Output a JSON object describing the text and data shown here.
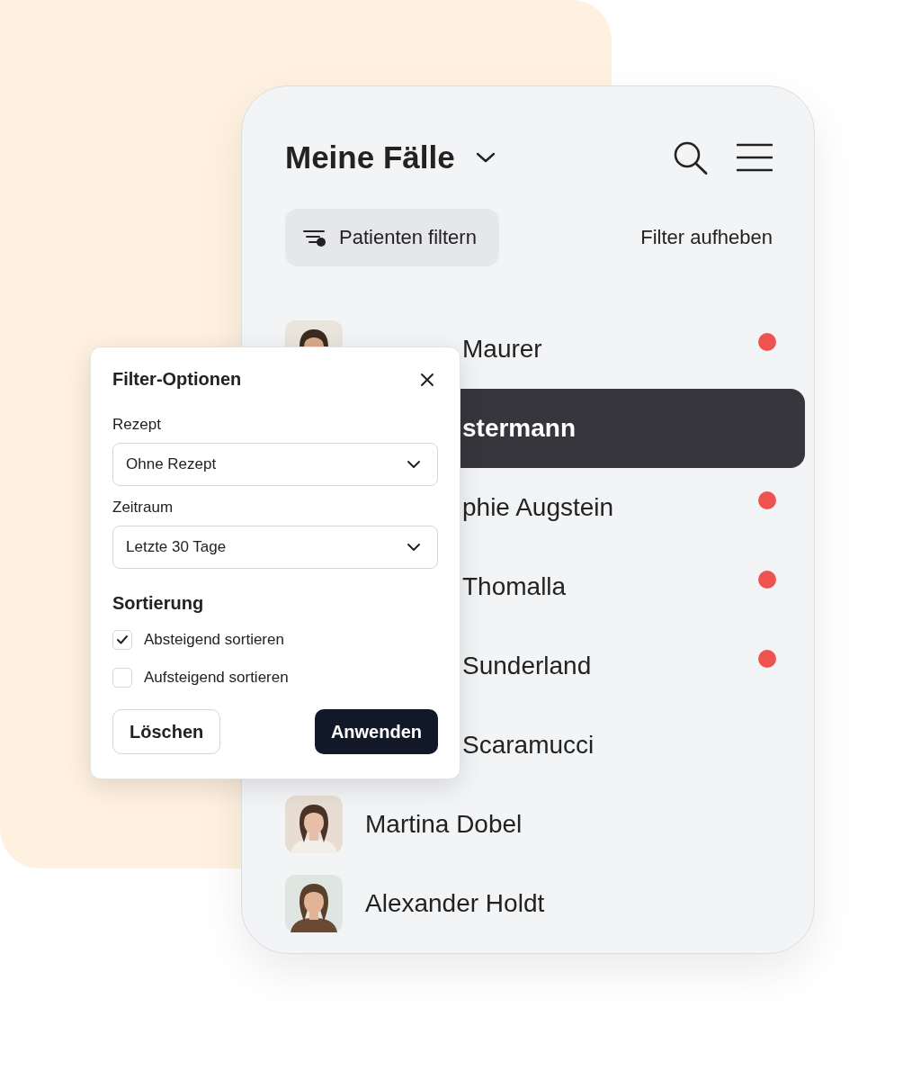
{
  "header": {
    "title": "Meine Fälle"
  },
  "filter_button": {
    "label": "Patienten filtern"
  },
  "clear_filter": {
    "label": "Filter aufheben"
  },
  "patients": [
    {
      "name": "Maurer",
      "avatar": true,
      "clipped": true,
      "selected": false,
      "unread": true
    },
    {
      "name": "stermann",
      "avatar": false,
      "clipped": true,
      "selected": true,
      "unread": false
    },
    {
      "name": "phie Augstein",
      "avatar": false,
      "clipped": true,
      "selected": false,
      "unread": true
    },
    {
      "name": "Thomalla",
      "avatar": false,
      "clipped": true,
      "selected": false,
      "unread": true
    },
    {
      "name": "Sunderland",
      "avatar": false,
      "clipped": true,
      "selected": false,
      "unread": true
    },
    {
      "name": "Scaramucci",
      "avatar": false,
      "clipped": true,
      "selected": false,
      "unread": false
    },
    {
      "name": "Martina Dobel",
      "avatar": true,
      "clipped": false,
      "selected": false,
      "unread": false
    },
    {
      "name": "Alexander Holdt",
      "avatar": true,
      "clipped": false,
      "selected": false,
      "unread": false
    }
  ],
  "filter_popover": {
    "title": "Filter-Optionen",
    "fields": [
      {
        "label": "Rezept",
        "value": "Ohne Rezept"
      },
      {
        "label": "Zeitraum",
        "value": "Letzte 30 Tage"
      }
    ],
    "sort_heading": "Sortierung",
    "sort_options": [
      {
        "label": "Absteigend sortieren",
        "checked": true
      },
      {
        "label": "Aufsteigend sortieren",
        "checked": false
      }
    ],
    "buttons": [
      {
        "label": "Löschen",
        "kind": "secondary"
      },
      {
        "label": "Anwenden",
        "kind": "primary"
      }
    ]
  }
}
